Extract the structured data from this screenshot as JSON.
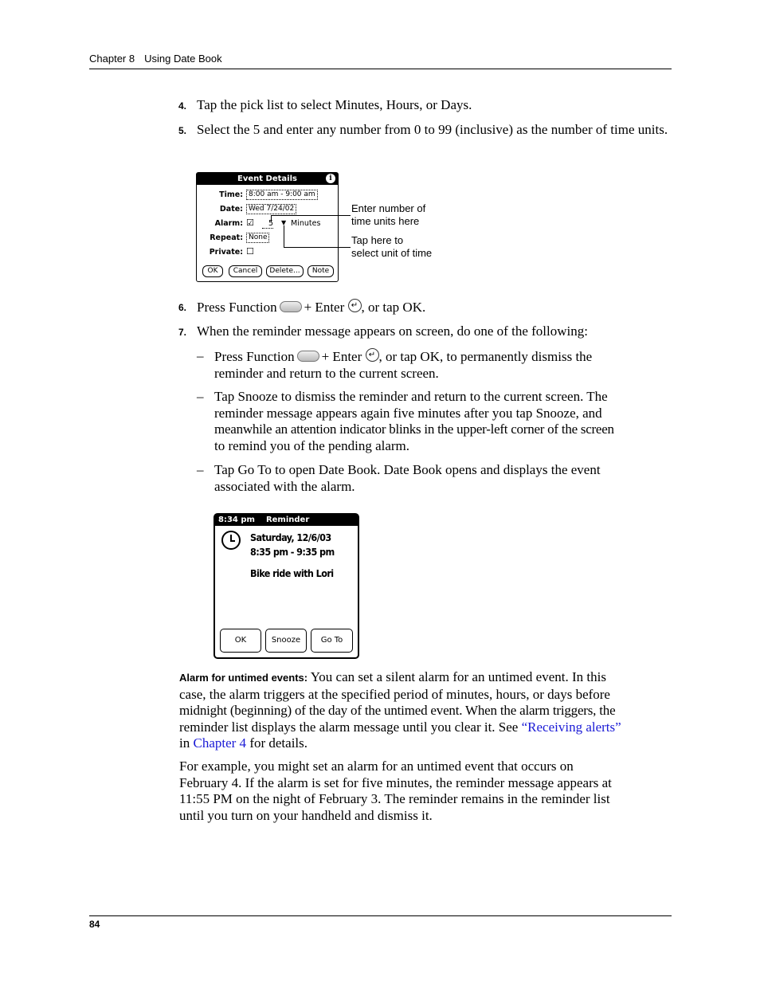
{
  "header": {
    "chapter": "Chapter 8",
    "section": "Using Date Book"
  },
  "steps": [
    {
      "num": "4.",
      "text": "Tap the pick list to select Minutes, Hours, or Days."
    },
    {
      "num": "5.",
      "text": "Select the 5 and enter any number from 0 to 99 (inclusive) as the number of time units."
    },
    {
      "num": "6.",
      "text_a": "Press Function",
      "text_b": "+ Enter",
      "text_c": ", or tap OK."
    },
    {
      "num": "7.",
      "text": "When the reminder message appears on screen, do one of the following:"
    }
  ],
  "sub_items": [
    {
      "dash": "–",
      "text_a": "Press Function",
      "text_b": "+ Enter",
      "text_c": ", or tap OK, to permanently dismiss the",
      "text_d": "reminder and return to the current screen."
    },
    {
      "dash": "–",
      "lines": [
        "Tap Snooze to dismiss the reminder and return to the current screen. The",
        "reminder message appears again five minutes after you tap Snooze, and",
        "meanwhile an attention indicator blinks in the upper-left corner of the screen",
        "to remind you of the pending alarm."
      ]
    },
    {
      "dash": "–",
      "lines": [
        "Tap Go To to open Date Book. Date Book opens and displays the event",
        "associated with the alarm."
      ]
    }
  ],
  "event_details": {
    "title": "Event Details",
    "info_icon": "i",
    "rows": [
      {
        "label": "Time:",
        "value": "8:00 am - 9:00 am"
      },
      {
        "label": "Date:",
        "value": "Wed 7/24/02"
      },
      {
        "label": "Alarm:",
        "check": "☑",
        "number": "5",
        "unit": "Minutes"
      },
      {
        "label": "Repeat:",
        "value": "None"
      },
      {
        "label": "Private:",
        "check": "☐"
      }
    ],
    "buttons": [
      "OK",
      "Cancel",
      "Delete...",
      "Note"
    ]
  },
  "callouts": [
    {
      "lines": [
        "Enter number of",
        "time units here"
      ]
    },
    {
      "lines": [
        "Tap here to",
        "select unit of time"
      ]
    }
  ],
  "reminder": {
    "time": "8:34 pm",
    "title": "Reminder",
    "date": "Saturday, 12/6/03",
    "range": "8:35 pm - 9:35 pm",
    "event": "Bike ride with Lori",
    "buttons": [
      "OK",
      "Snooze",
      "Go To"
    ]
  },
  "untimed": {
    "heading": "Alarm for untimed events:",
    "line1": " You can set a silent alarm for an untimed event. In this",
    "line2": "case, the alarm triggers at the specified period of minutes, hours, or days before",
    "line3": "midnight (beginning) of the day of the untimed event. When the alarm triggers, the",
    "line4": "reminder list displays the alarm message until you clear it. See ",
    "link1": "“Receiving alerts”",
    "line5a": "in ",
    "link2": "Chapter 4",
    "line5b": " for details."
  },
  "example": {
    "lines": [
      "For example, you might set an alarm for an untimed event that occurs on",
      "February 4. If the alarm is set for five minutes, the reminder message appears at",
      "11:55 PM on the night of February 3. The reminder remains in the reminder list",
      "until you turn on your handheld and dismiss it."
    ]
  },
  "footer": {
    "page": "84"
  },
  "colors": {
    "link": "#1a1ad6"
  }
}
